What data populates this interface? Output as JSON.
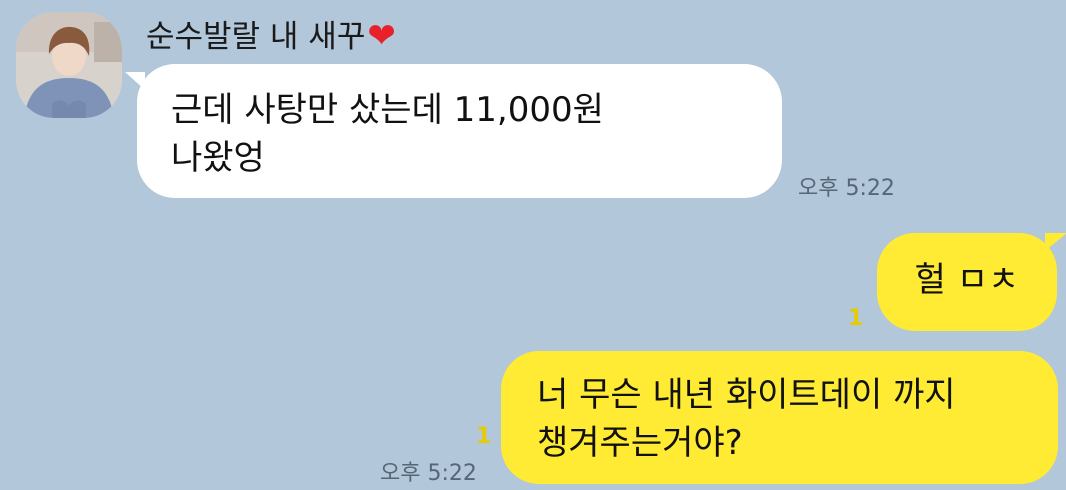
{
  "chat": {
    "sender_name": "순수발랄 내 새꾸",
    "sender_heart": "❤",
    "messages": [
      {
        "direction": "incoming",
        "lines": [
          "근데 사탕만 샀는데 11,000원",
          "나왔엉"
        ],
        "time": "오후 5:22"
      },
      {
        "direction": "outgoing",
        "lines": [
          "헐 ㅁㅊ"
        ],
        "unread": "1"
      },
      {
        "direction": "outgoing",
        "lines": [
          "너 무슨 내년 화이트데이 까지",
          "챙겨주는거야?"
        ],
        "unread": "1",
        "time": "오후 5:22"
      }
    ]
  },
  "colors": {
    "background": "#b2c7d9",
    "incoming_bubble": "#ffffff",
    "outgoing_bubble": "#ffeb33",
    "unread_count": "#e5cc00"
  }
}
